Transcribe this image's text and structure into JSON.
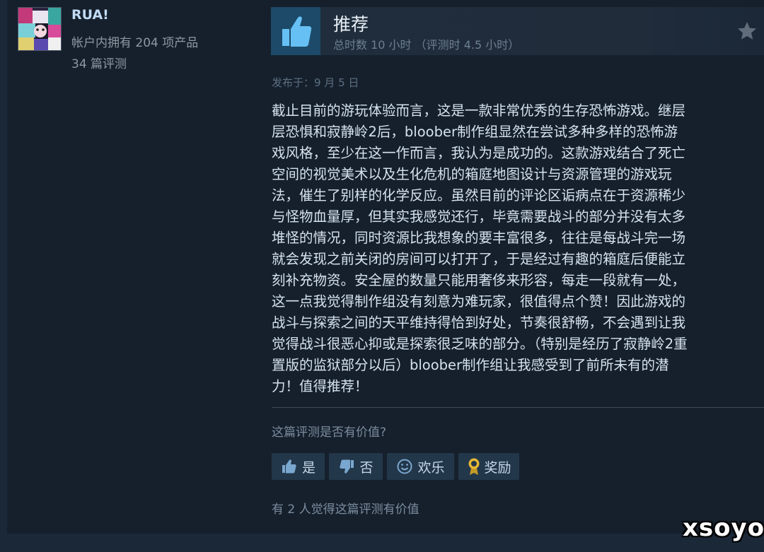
{
  "reviewer": {
    "name": "RUA!",
    "products_owned": "帐户内拥有 204 项产品",
    "review_count": "34 篇评测"
  },
  "review": {
    "verdict": "推荐",
    "hours": "总时数 10 小时 （评测时 4.5 小时）",
    "posted": "发布于：9 月 5 日",
    "text": "截止目前的游玩体验而言，这是一款非常优秀的生存恐怖游戏。继层\n层恐惧和寂静岭2后，bloober制作组显然在尝试多种多样的恐怖游\n戏风格，至少在这一作而言，我认为是成功的。这款游戏结合了死亡\n空间的视觉美术以及生化危机的箱庭地图设计与资源管理的游戏玩\n法，催生了别样的化学反应。虽然目前的评论区诟病点在于资源稀少\n与怪物血量厚，但其实我感觉还行，毕竟需要战斗的部分并没有太多\n堆怪的情况，同时资源比我想象的要丰富很多，往往是每战斗完一场\n就会发现之前关闭的房间可以打开了，于是经过有趣的箱庭后便能立\n刻补充物资。安全屋的数量只能用奢侈来形容，每走一段就有一处，\n这一点我觉得制作组没有刻意为难玩家，很值得点个赞！因此游戏的\n战斗与探索之间的天平维持得恰到好处，节奏很舒畅，不会遇到让我\n觉得战斗很恶心抑或是探索很乏味的部分。（特别是经历了寂静岭2重\n置版的监狱部分以后）bloober制作组让我感受到了前所未有的潜\n力！值得推荐！"
  },
  "feedback": {
    "question": "这篇评测是否有价值?",
    "yes_label": "是",
    "no_label": "否",
    "funny_label": "欢乐",
    "award_label": "奖励",
    "helpful_count": "有 2 人觉得这篇评测有价值"
  },
  "watermark": "xsoyo",
  "icons": {
    "verdict": "thumbs-up-icon",
    "star": "star-icon",
    "yes": "thumbs-up-icon",
    "no": "thumbs-down-icon",
    "funny": "smiley-icon",
    "award": "award-medal-icon"
  },
  "colors": {
    "background": "#1b2838",
    "card": "#16202d",
    "thumb_box": "#1d4a69",
    "thumb_icon": "#66c0f4",
    "button_bg": "#23374a",
    "username": "#c1dbf4",
    "award_gold": "#e6b833"
  }
}
